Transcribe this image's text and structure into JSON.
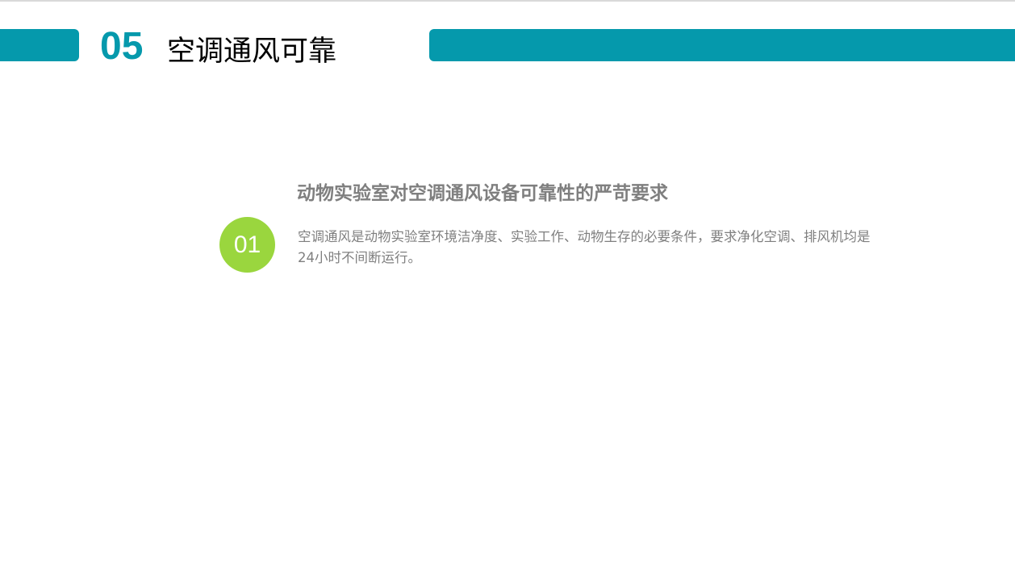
{
  "header": {
    "section_number": "05",
    "section_title": "空调通风可靠"
  },
  "point": {
    "number": "01",
    "heading": "动物实验室对空调通风设备可靠性的严苛要求",
    "body": "空调通风是动物实验室环境洁净度、实验工作、动物生存的必要条件，要求净化空调、排风机均是24小时不间断运行。"
  },
  "colors": {
    "accent": "#0599ac",
    "badge": "#9ad63e",
    "text_gray": "#7f7f7f"
  }
}
